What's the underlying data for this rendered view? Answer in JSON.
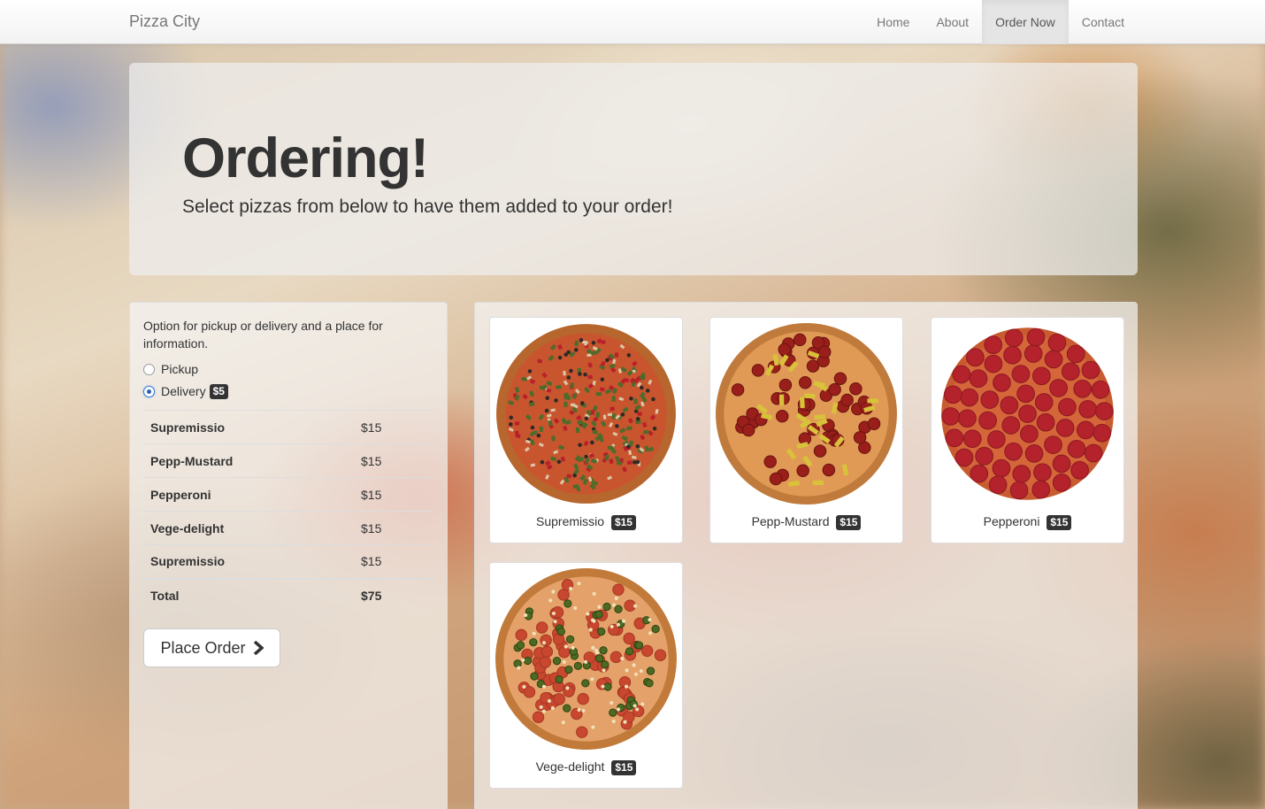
{
  "navbar": {
    "brand": "Pizza City",
    "items": [
      {
        "label": "Home",
        "active": false
      },
      {
        "label": "About",
        "active": false
      },
      {
        "label": "Order Now",
        "active": true
      },
      {
        "label": "Contact",
        "active": false
      }
    ]
  },
  "jumbotron": {
    "title": "Ordering!",
    "subtitle": "Select pizzas from below to have them added to your order!"
  },
  "order": {
    "description": "Option for pickup or delivery and a place for information.",
    "options": [
      {
        "label": "Pickup",
        "checked": false,
        "badge": ""
      },
      {
        "label": "Delivery",
        "checked": true,
        "badge": "$5"
      }
    ],
    "items": [
      {
        "name": "Supremissio",
        "price": "$15"
      },
      {
        "name": "Pepp-Mustard",
        "price": "$15"
      },
      {
        "name": "Pepperoni",
        "price": "$15"
      },
      {
        "name": "Vege-delight",
        "price": "$15"
      },
      {
        "name": "Supremissio",
        "price": "$15"
      }
    ],
    "total_label": "Total",
    "total_value": "$75",
    "place_order_label": "Place Order"
  },
  "menu": {
    "pizzas": [
      {
        "name": "Supremissio",
        "price": "$15",
        "icon": "supreme-pizza-icon"
      },
      {
        "name": "Pepp-Mustard",
        "price": "$15",
        "icon": "pepperoni-pepper-pizza-icon"
      },
      {
        "name": "Pepperoni",
        "price": "$15",
        "icon": "pepperoni-pizza-icon"
      },
      {
        "name": "Vege-delight",
        "price": "$15",
        "icon": "pepperoni-jalapeno-pizza-icon"
      }
    ]
  },
  "colors": {
    "badge": "#333333",
    "radio_checked": "#2a5fb0",
    "active_nav": "#e5e5e5"
  }
}
